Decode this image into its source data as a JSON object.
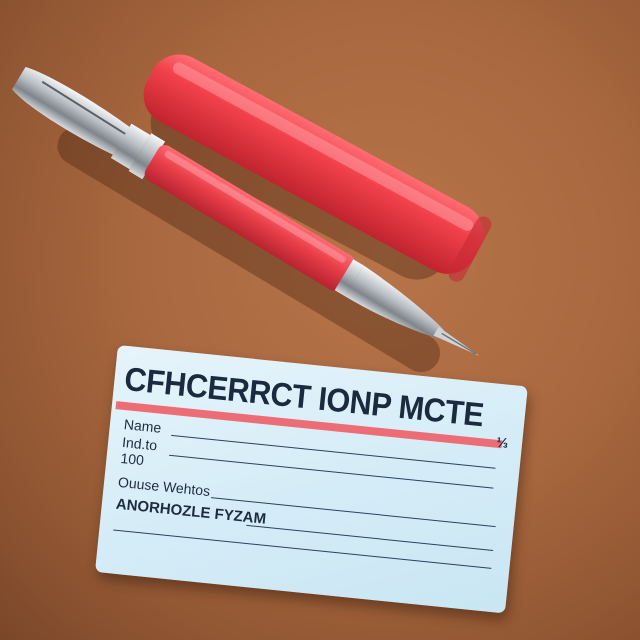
{
  "scene": {
    "background_color": "#a9683f",
    "objects": [
      "red-fountain-pen",
      "pen-cap",
      "blue-name-card"
    ]
  },
  "card": {
    "title": "CFHCERRCT IONP MCTE",
    "corner_mark": "⅓",
    "fields": [
      {
        "label": "Name"
      },
      {
        "label": "Ind.to"
      },
      {
        "label": "100"
      },
      {
        "label": "Ouuse Wehtos"
      },
      {
        "label": "ANORHOZLE FYZAM"
      }
    ],
    "colors": {
      "card": "#d4ecf7",
      "stripe": "#ec6d76",
      "pen_body": "#e8414c",
      "metal": "#c8ccd0"
    }
  }
}
